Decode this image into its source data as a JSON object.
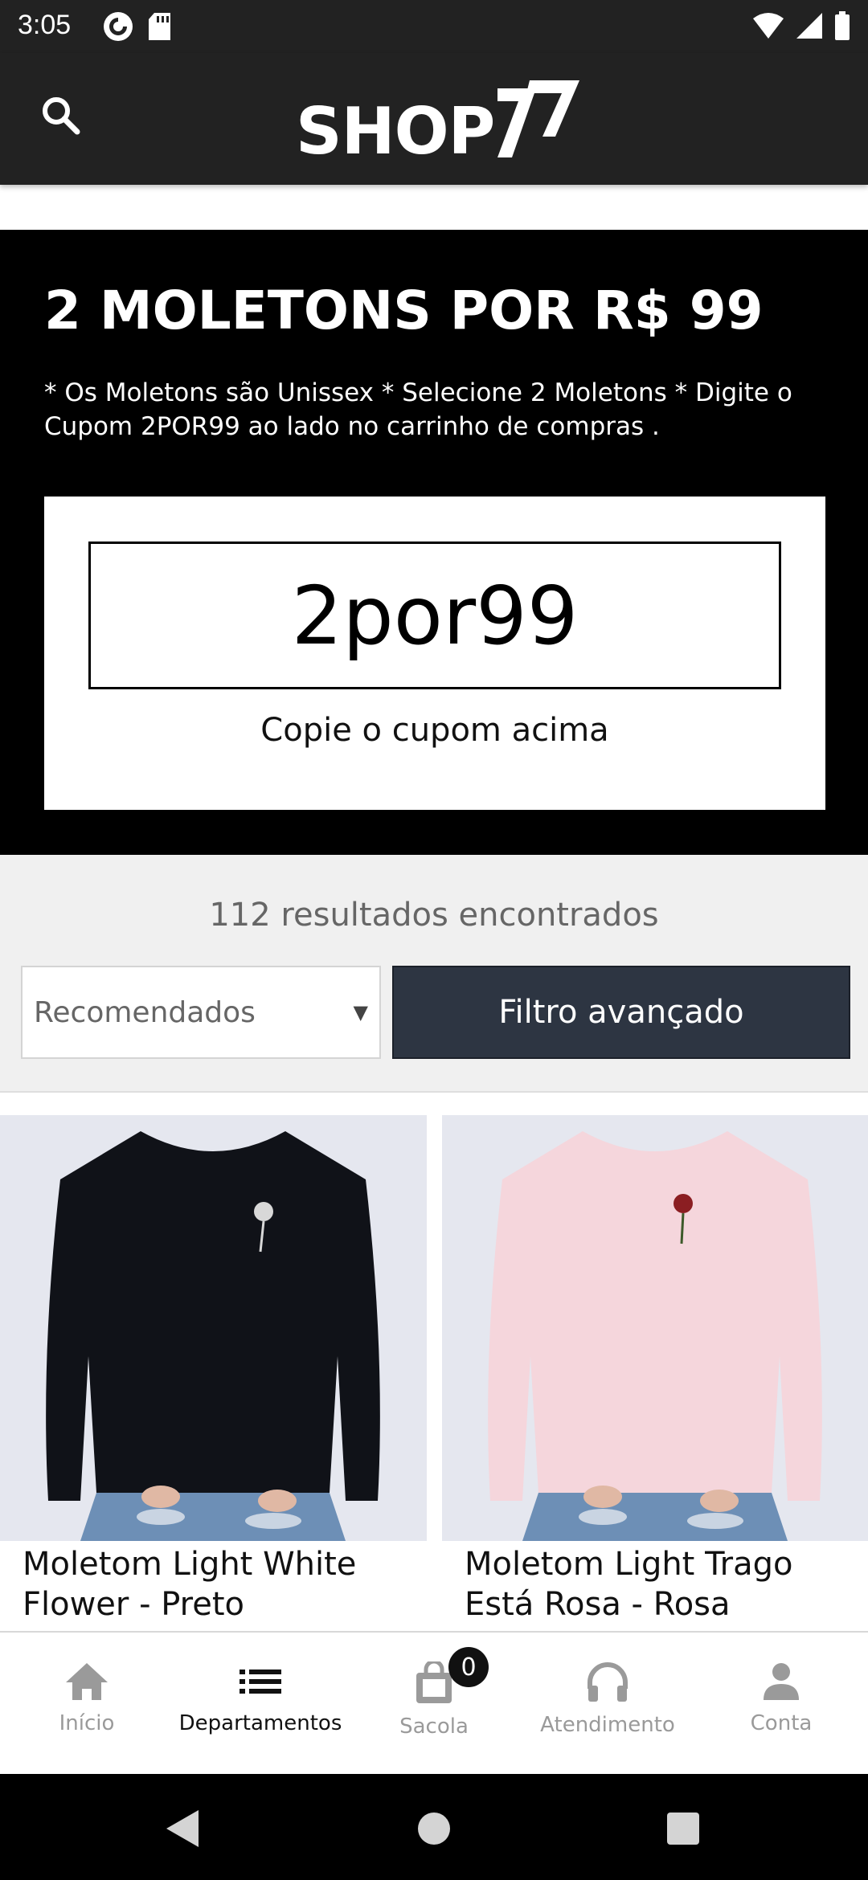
{
  "status_bar": {
    "time": "3:05"
  },
  "app_bar": {
    "logo_text": "SHOP",
    "logo_suffix": "77"
  },
  "promo": {
    "title": "2 MOLETONS POR R$ 99",
    "description": "* Os Moletons são Unissex * Selecione 2 Moletons * Digite o Cupom 2POR99 ao lado no carrinho de compras .",
    "coupon_code": "2por99",
    "coupon_hint": "Copie o cupom acima"
  },
  "filters": {
    "results_text": "112 resultados encontrados",
    "sort_selected": "Recomendados",
    "advanced_filter_label": "Filtro avançado"
  },
  "products": [
    {
      "name": "Moletom Light White Flower - Preto",
      "shirt_color": "#101218"
    },
    {
      "name": "Moletom Light Trago Está Rosa - Rosa",
      "shirt_color": "#f5d6dc"
    }
  ],
  "bottom_nav": {
    "items": [
      {
        "label": "Início",
        "icon": "home-icon"
      },
      {
        "label": "Departamentos",
        "icon": "list-icon"
      },
      {
        "label": "Sacola",
        "icon": "bag-icon"
      },
      {
        "label": "Atendimento",
        "icon": "headset-icon"
      },
      {
        "label": "Conta",
        "icon": "person-icon"
      }
    ],
    "active_index": 1,
    "cart_count": "0"
  },
  "colors": {
    "app_bar_bg": "#222222",
    "promo_bg": "#000000",
    "filter_button_bg": "#2d3542"
  }
}
